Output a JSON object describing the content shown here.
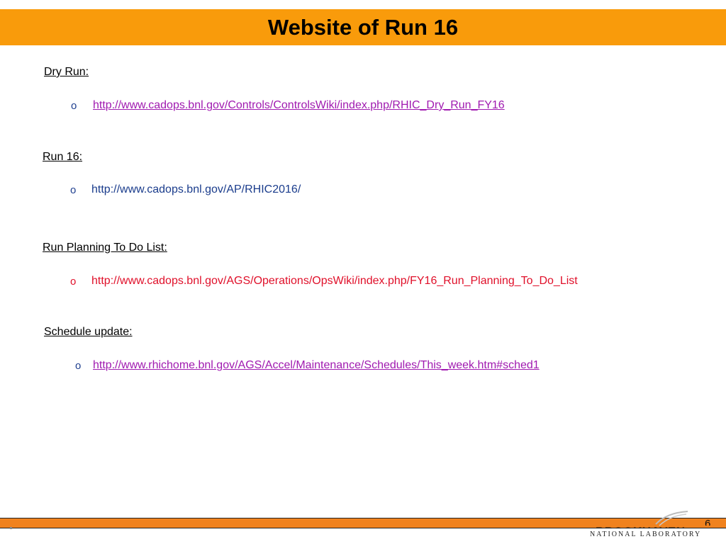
{
  "slide": {
    "title": "Website of Run 16"
  },
  "sections": [
    {
      "heading": "Dry Run:",
      "bullet": "o",
      "link": "http://www.cadops.bnl.gov/Controls/ControlsWiki/index.php/RHIC_Dry_Run_FY16"
    },
    {
      "heading": "Run 16:",
      "bullet": "o",
      "link": "http://www.cadops.bnl.gov/AP/RHIC2016/"
    },
    {
      "heading": "Run Planning To Do List:",
      "bullet": "o",
      "link": "http://www.cadops.bnl.gov/AGS/Operations/OpsWiki/index.php/FY16_Run_Planning_To_Do_List"
    },
    {
      "heading": "Schedule update:",
      "bullet": "o",
      "link": "http://www.rhichome.bnl.gov/AGS/Accel/Maintenance/Schedules/This_week.htm#sched1"
    }
  ],
  "footer": {
    "logo_top": "BROOKHAVEN",
    "logo_bottom": "NATIONAL LABORATORY",
    "page_number": "6"
  },
  "colors": {
    "title_bar": "#f99b0b",
    "footer_bar": "#f0821e",
    "link_purple": "#a01ab0",
    "link_blue": "#1a3c8c",
    "link_red": "#e0102a"
  }
}
